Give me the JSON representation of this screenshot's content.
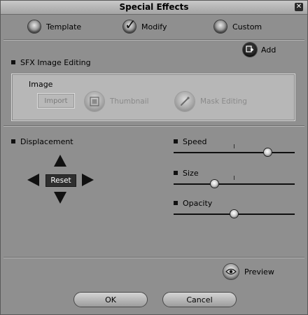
{
  "window": {
    "title": "Special Effects",
    "close_glyph": "✕"
  },
  "tabs": [
    {
      "label": "Template",
      "selected": false
    },
    {
      "label": "Modify",
      "selected": true
    },
    {
      "label": "Custom",
      "selected": false
    }
  ],
  "toolbar": {
    "add_label": "Add",
    "add_icon": "add-layer-icon"
  },
  "sfx_section": {
    "title": "SFX Image Editing",
    "image_label": "Image",
    "import_label": "Import",
    "thumbnail_label": "Thumbnail",
    "thumbnail_icon": "thumbnail-icon",
    "mask_label": "Mask Editing",
    "mask_icon": "brush-icon"
  },
  "displacement": {
    "title": "Displacement",
    "reset_label": "Reset"
  },
  "sliders": [
    {
      "label": "Speed",
      "value": 0.78
    },
    {
      "label": "Size",
      "value": 0.34
    },
    {
      "label": "Opacity",
      "value": 0.5
    }
  ],
  "preview": {
    "label": "Preview",
    "icon": "eye-icon"
  },
  "buttons": {
    "ok_label": "OK",
    "cancel_label": "Cancel"
  }
}
